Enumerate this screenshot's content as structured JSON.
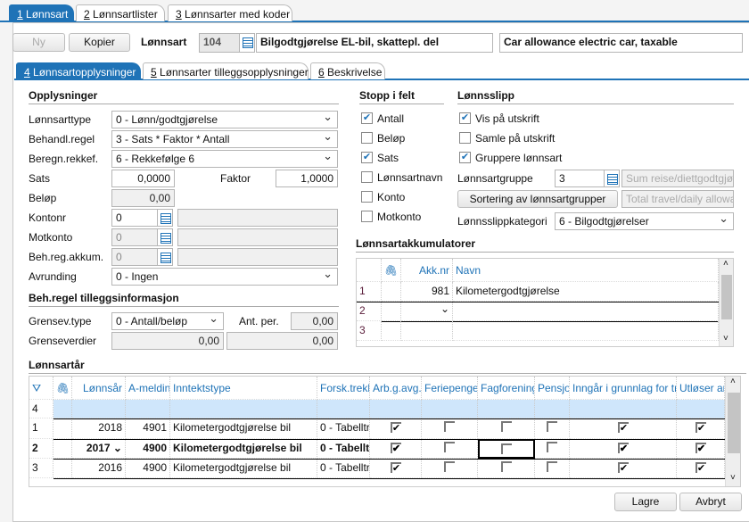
{
  "top_tabs": [
    {
      "key": "1",
      "label": " Lønnsart"
    },
    {
      "key": "2",
      "label": " Lønnsartlister"
    },
    {
      "key": "3",
      "label": " Lønnsarter med koder"
    }
  ],
  "toolbar": {
    "new": "Ny",
    "copy": "Kopier",
    "label": "Lønnsart",
    "number": "104",
    "name": "Bilgodtgjørelse EL-bil, skattepl. del",
    "name_en": "Car allowance electric car, taxable"
  },
  "sub_tabs": [
    {
      "key": "4",
      "label": " Lønnsartopplysninger"
    },
    {
      "key": "5",
      "label": " Lønnsarter tilleggsopplysninger"
    },
    {
      "key": "6",
      "label": " Beskrivelse"
    }
  ],
  "info": {
    "title": "Opplysninger",
    "type_label": "Lønnsarttype",
    "type": "0 - Lønn/godtgjørelse",
    "rule_label": "Behandl.regel",
    "rule": "3 - Sats * Faktor * Antall",
    "order_label": "Beregn.rekkef.",
    "order": "6 - Rekkefølge 6",
    "rate_label": "Sats",
    "rate": "0,0000",
    "factor_label": "Faktor",
    "factor": "1,0000",
    "amount_label": "Beløp",
    "amount": "0,00",
    "account_label": "Kontonr",
    "account": "0",
    "counter_label": "Motkonto",
    "counter": "0",
    "acc_label": "Beh.reg.akkum.",
    "acc": "0",
    "round_label": "Avrunding",
    "round": "0 - Ingen"
  },
  "extra": {
    "title": "Beh.regel tilleggsinformasjon",
    "limit_type_label": "Grensev.type",
    "limit_type": "0 - Antall/beløp",
    "per_label": "Ant. per.",
    "per": "0,00",
    "limits_label": "Grenseverdier",
    "limit1": "0,00",
    "limit2": "0,00"
  },
  "stop": {
    "title": "Stopp i felt",
    "items": [
      {
        "label": "Antall",
        "checked": true
      },
      {
        "label": "Beløp",
        "checked": false
      },
      {
        "label": "Sats",
        "checked": true
      },
      {
        "label": "Lønnsartnavn",
        "checked": false
      },
      {
        "label": "Konto",
        "checked": false
      },
      {
        "label": "Motkonto",
        "checked": false
      }
    ]
  },
  "payslip": {
    "title": "Lønnsslipp",
    "items": [
      {
        "label": "Vis på utskrift",
        "checked": true
      },
      {
        "label": "Samle på utskrift",
        "checked": false
      },
      {
        "label": "Gruppere lønnsart",
        "checked": true
      }
    ],
    "group_label": "Lønnsartgruppe",
    "group": "3",
    "group_name": "Sum reise/diettgodtgjør",
    "sort_button": "Sortering av lønnsartgrupper",
    "group_name_en": "Total travel/daily allowa",
    "category_label": "Lønnsslippkategori",
    "category": "6 - Bilgodtgjørelser"
  },
  "accumulators": {
    "title": "Lønnsartakkumulatorer",
    "columns": [
      "",
      "",
      "Akk.nr",
      "Navn"
    ],
    "rows": [
      [
        "1",
        "",
        "981",
        "Kilometergodtgjørelse"
      ],
      [
        "2",
        "",
        "",
        ""
      ],
      [
        "3",
        "",
        "",
        ""
      ]
    ]
  },
  "years": {
    "title": "Lønnsartår",
    "columns": [
      "",
      "",
      "Lønnsår",
      "A-meldin",
      "Inntektstype",
      "Forsk.trekk",
      "Arb.g.avg.",
      "Feriepenger",
      "Fagforening",
      "Pensjo",
      "Inngår i grunnlag for trek",
      "Utløser ar"
    ],
    "rows": [
      {
        "cells": [
          "4",
          "",
          "",
          "",
          "",
          "",
          null,
          null,
          null,
          null,
          null,
          null
        ],
        "new": true
      },
      {
        "cells": [
          "1",
          "",
          "2018",
          "4901",
          "Kilometergodtgjørelse bil",
          "0 - Tabelltre",
          true,
          false,
          false,
          false,
          true,
          true
        ]
      },
      {
        "cells": [
          "2",
          "",
          "2017",
          "4900",
          "Kilometergodtgjørelse bil",
          "0 - Tabellt",
          true,
          false,
          false,
          false,
          true,
          true
        ],
        "current": true
      },
      {
        "cells": [
          "3",
          "",
          "2016",
          "4900",
          "Kilometergodtgjørelse bil",
          "0 - Tabelltre",
          true,
          false,
          false,
          false,
          true,
          true
        ]
      }
    ]
  },
  "footer": {
    "save": "Lagre",
    "cancel": "Avbryt"
  },
  "colors": {
    "accent": "#1f73b7",
    "selected_row": "#cfe6fb"
  }
}
